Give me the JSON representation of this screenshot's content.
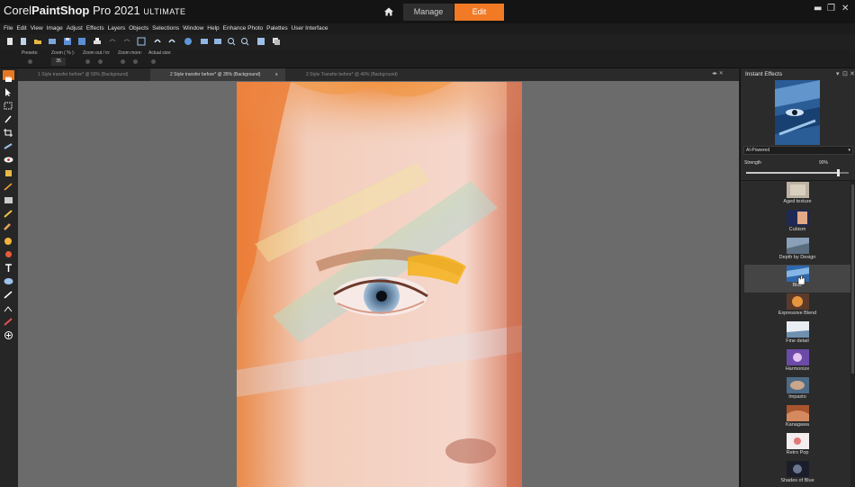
{
  "app": {
    "title_brand": "Corel",
    "title_product": "PaintShop",
    "title_pro": "Pro 2021",
    "title_edition": "ULTIMATE"
  },
  "workspace_tabs": {
    "manage": "Manage",
    "edit": "Edit"
  },
  "window_controls": {
    "minimize": "▬",
    "restore": "❐",
    "close": "✕"
  },
  "menu": [
    "File",
    "Edit",
    "View",
    "Image",
    "Adjust",
    "Effects",
    "Layers",
    "Objects",
    "Selections",
    "Window",
    "Help",
    "Enhance Photo",
    "Palettes",
    "User Interface"
  ],
  "options": {
    "presets_label": "Presets:",
    "zoom_label": "Zoom ( % ):",
    "zoom_value": "35",
    "zoom_out_in_label": "Zoom out / in:",
    "zoom_more_label": "Zoom more:",
    "actual_size_label": "Actual size:"
  },
  "doc_tabs": [
    "1 Style transfer before* @  50% (Background)",
    "2 Style transfer before* @  35% (Background)",
    "3 Style Transfer before* @  49% (Background)"
  ],
  "doc_tab_close": "x",
  "panel": {
    "title": "Instant Effects",
    "dropdown_value": "AI-Powered",
    "strength_label": "Strength",
    "strength_value": "90%",
    "strength_fraction": 0.9,
    "effects": [
      "Aged texture",
      "Cubism",
      "Depth by Design",
      "Blue",
      "Expressive Blend",
      "Fine detail",
      "Harmonize",
      "Impasto",
      "Kanagawa",
      "Retro Pop",
      "Shades of Blue"
    ]
  },
  "colors": {
    "accent": "#f27a25",
    "background": "#1f1f1f",
    "canvas": "#6b6b6b",
    "panel": "#2b2b2b"
  }
}
